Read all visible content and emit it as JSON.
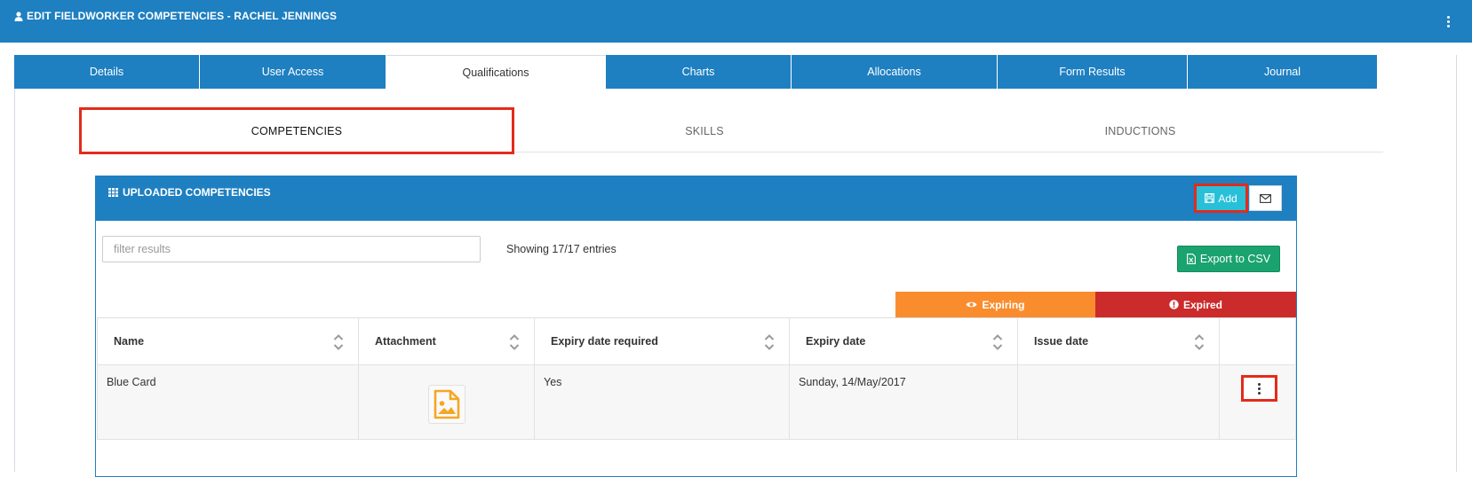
{
  "header": {
    "title": "EDIT FIELDWORKER COMPETENCIES - RACHEL JENNINGS"
  },
  "main_tabs": [
    {
      "label": "Details"
    },
    {
      "label": "User Access"
    },
    {
      "label": "Qualifications",
      "active": true
    },
    {
      "label": "Charts"
    },
    {
      "label": "Allocations"
    },
    {
      "label": "Form Results"
    },
    {
      "label": "Journal"
    }
  ],
  "sub_tabs": [
    {
      "label": "COMPETENCIES",
      "active": true
    },
    {
      "label": "SKILLS"
    },
    {
      "label": "INDUCTIONS"
    }
  ],
  "widget": {
    "title": "UPLOADED COMPETENCIES",
    "add_label": "Add",
    "filter_placeholder": "filter results",
    "showing": "Showing 17/17 entries",
    "export_label": "Export to CSV",
    "legend": {
      "expiring": "Expiring",
      "expired": "Expired"
    }
  },
  "table": {
    "columns": [
      "Name",
      "Attachment",
      "Expiry date required",
      "Expiry date",
      "Issue date"
    ],
    "rows": [
      {
        "name": "Blue Card",
        "expiry_required": "Yes",
        "expiry_date": "Sunday, 14/May/2017",
        "issue_date": ""
      }
    ]
  },
  "colors": {
    "primary": "#1e7fc1",
    "highlight": "#e32b1a",
    "add_button": "#28c0d8",
    "export_button": "#1aa36f",
    "expiring": "#f98d2e",
    "expired": "#cc2b2b"
  }
}
